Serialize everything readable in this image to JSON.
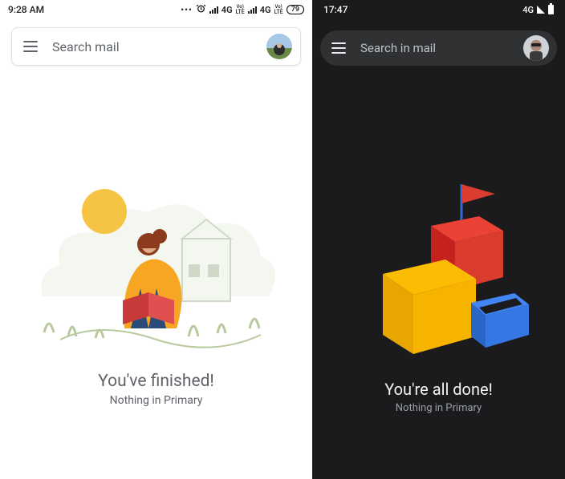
{
  "light": {
    "status": {
      "time": "9:28 AM",
      "dots": "•••",
      "net1_label": "4G",
      "net1_sub": "Vo LTE",
      "net2_label": "4G",
      "net2_sub": "Vo LTE",
      "battery": "79"
    },
    "search": {
      "placeholder": "Search mail"
    },
    "empty": {
      "headline": "You've finished!",
      "subline": "Nothing in Primary"
    }
  },
  "dark": {
    "status": {
      "time": "17:47",
      "net_label": "4G"
    },
    "search": {
      "placeholder": "Search in mail"
    },
    "empty": {
      "headline": "You're all done!",
      "subline": "Nothing in Primary"
    }
  }
}
